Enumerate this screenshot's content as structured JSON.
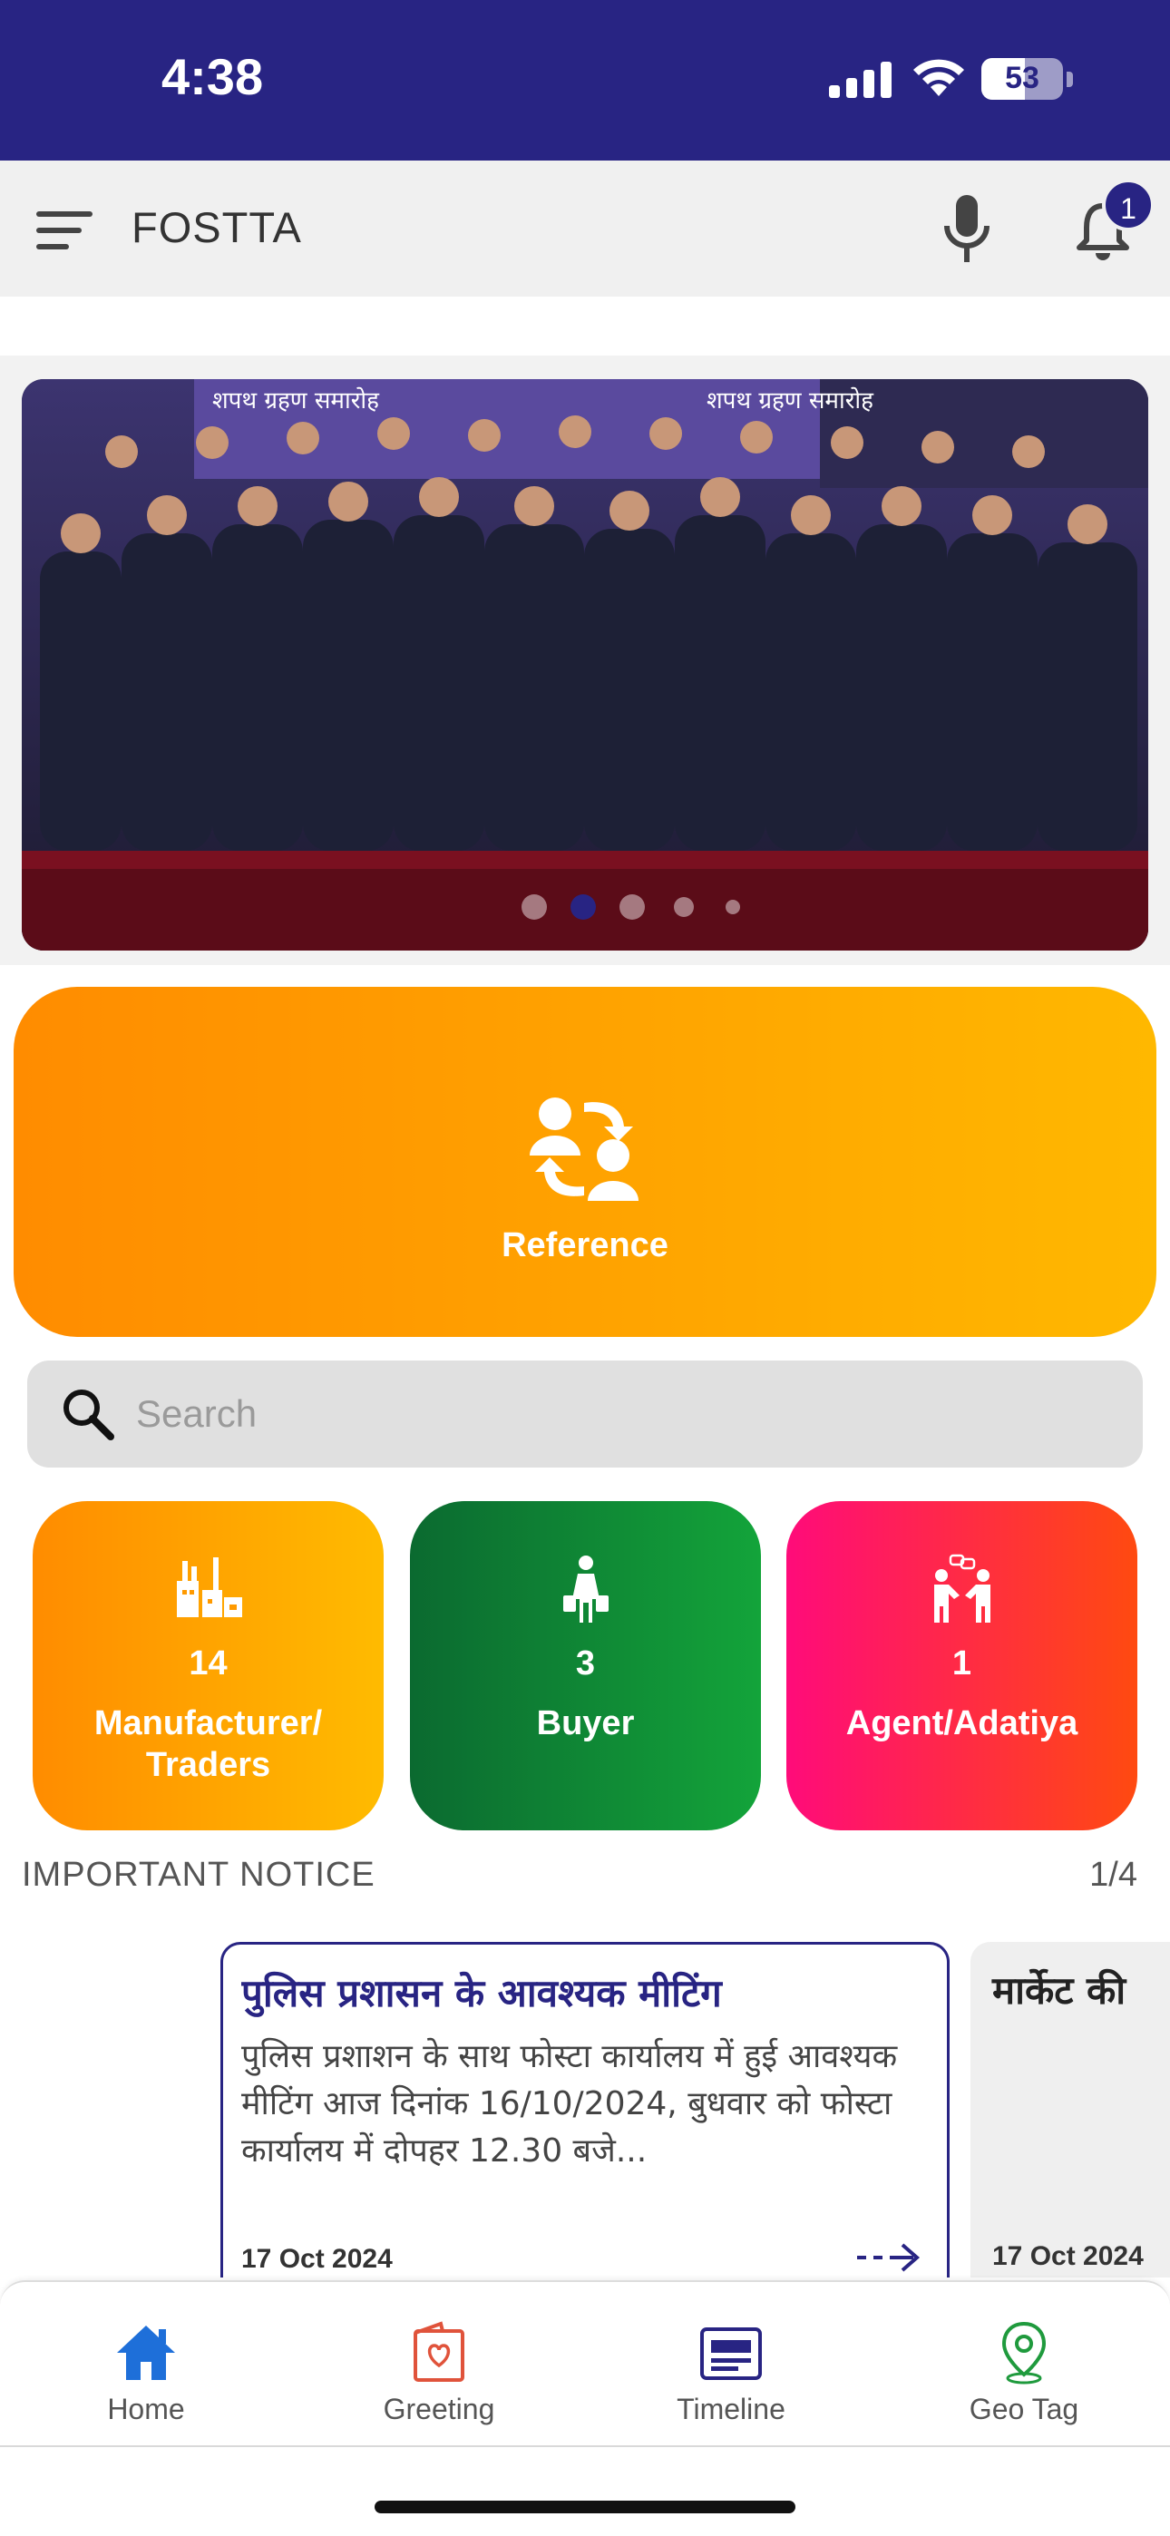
{
  "status_bar": {
    "time": "4:38",
    "battery_level": "53",
    "battery_fraction": 0.53
  },
  "app_bar": {
    "title": "FOSTTA",
    "notification_count": "1"
  },
  "carousel": {
    "slide_count": 5,
    "active_index": 1,
    "banner_text_left": "शपथ ग्रहण समारोह",
    "banner_text_right": "शपथ ग्रहण समारोह"
  },
  "reference": {
    "label": "Reference"
  },
  "search": {
    "placeholder": "Search",
    "value": ""
  },
  "categories": [
    {
      "count": "14",
      "label": "Manufacturer/ Traders",
      "icon": "factory-icon"
    },
    {
      "count": "3",
      "label": "Buyer",
      "icon": "buyer-icon"
    },
    {
      "count": "1",
      "label": "Agent/Adatiya",
      "icon": "agent-handshake-icon"
    }
  ],
  "notices": {
    "heading": "IMPORTANT NOTICE",
    "counter": "1/4",
    "items": [
      {
        "title": "पुलिस प्रशासन के आवश्यक मीटिंग",
        "body": "पुलिस प्रशाशन के साथ फोस्टा कार्यालय में हुई आवश्यक मीटिंग आज दिनांक 16/10/2024, बुधवार को फोस्टा कार्यालय में दोपहर 12.30 बजे...",
        "date": "17 Oct 2024"
      },
      {
        "title": "मार्केट की",
        "date": "17 Oct 2024"
      }
    ]
  },
  "bottom_nav": {
    "items": [
      {
        "label": "Home",
        "icon": "home-icon",
        "active": true
      },
      {
        "label": "Greeting",
        "icon": "greeting-card-icon"
      },
      {
        "label": "Timeline",
        "icon": "timeline-icon"
      },
      {
        "label": "Geo Tag",
        "icon": "location-pin-icon"
      }
    ]
  },
  "colors": {
    "primary": "#282483",
    "reference_gradient": [
      "#ff8c00",
      "#ffb800"
    ],
    "buyer_gradient": [
      "#0b6a30",
      "#13a43a"
    ],
    "agent_gradient": [
      "#ff0b7a",
      "#ff4a10"
    ],
    "home_active": "#1e6fd9",
    "greeting": "#e0533b",
    "timeline": "#282483",
    "geotag": "#1f9a3d"
  }
}
